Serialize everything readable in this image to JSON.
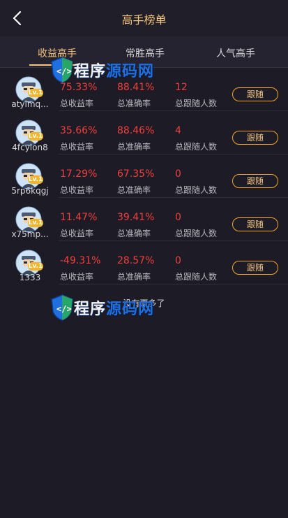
{
  "header": {
    "title": "高手榜单"
  },
  "tabs": [
    {
      "label": "收益高手",
      "active": true
    },
    {
      "label": "常胜高手",
      "active": false
    },
    {
      "label": "人气高手",
      "active": false
    }
  ],
  "rows": [
    {
      "username": "atyimq...",
      "level": "Lv.1",
      "yield": "75.33%",
      "accuracy": "88.41%",
      "followers": "12",
      "yield_label": "总收益率",
      "accuracy_label": "总准确率",
      "followers_label": "总跟随人数",
      "follow_label": "跟随"
    },
    {
      "username": "4fcylon8",
      "level": "Lv.1",
      "yield": "35.66%",
      "accuracy": "88.46%",
      "followers": "4",
      "yield_label": "总收益率",
      "accuracy_label": "总准确率",
      "followers_label": "总跟随人数",
      "follow_label": "跟随"
    },
    {
      "username": "5rp6kqgj",
      "level": "Lv.1",
      "yield": "17.29%",
      "accuracy": "67.35%",
      "followers": "0",
      "yield_label": "总收益率",
      "accuracy_label": "总准确率",
      "followers_label": "总跟随人数",
      "follow_label": "跟随"
    },
    {
      "username": "x75mp...",
      "level": "Lv.1",
      "yield": "11.47%",
      "accuracy": "39.41%",
      "followers": "0",
      "yield_label": "总收益率",
      "accuracy_label": "总准确率",
      "followers_label": "总跟随人数",
      "follow_label": "跟随"
    },
    {
      "username": "1333",
      "level": "Lv.1",
      "yield": "-49.31%",
      "accuracy": "28.57%",
      "followers": "0",
      "yield_label": "总收益率",
      "accuracy_label": "总准确率",
      "followers_label": "总跟随人数",
      "follow_label": "跟随"
    }
  ],
  "footer": {
    "no_more": "没有更多了"
  },
  "watermark": {
    "text_white": "程序",
    "text_blue": "源码网"
  },
  "colors": {
    "accent": "#f5c47d",
    "value_red": "#f0403c",
    "button_border": "#f5a623",
    "background": "#1c1b26"
  }
}
